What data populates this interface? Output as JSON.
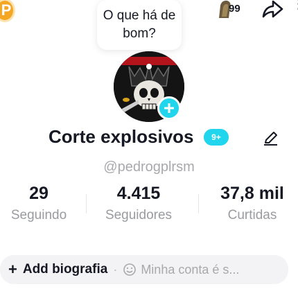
{
  "header": {
    "profile_badge_letter": "P",
    "prompt_bubble_text": "O que há de bom?",
    "notifications_count": "99",
    "icons": {
      "share": "share-arrow-icon",
      "menu": "more-icon"
    }
  },
  "profile": {
    "display_name": "Corte explosivos",
    "name_badge": "9+",
    "username": "@pedrogplrsm",
    "icons": {
      "add_avatar": "plus-icon",
      "edit": "pencil-icon"
    }
  },
  "stats": [
    {
      "value": "29",
      "label": "Seguindo"
    },
    {
      "value": "4.415",
      "label": "Seguidores"
    },
    {
      "value": "37,8 mil",
      "label": "Curtidas"
    }
  ],
  "bio": {
    "add_label": "Add biografia",
    "account_text": "Minha conta é s..."
  },
  "colors": {
    "accent": "#20d5ec",
    "badge_orange": "#f5a623",
    "text": "#161823",
    "muted": "#a8a8ad"
  }
}
